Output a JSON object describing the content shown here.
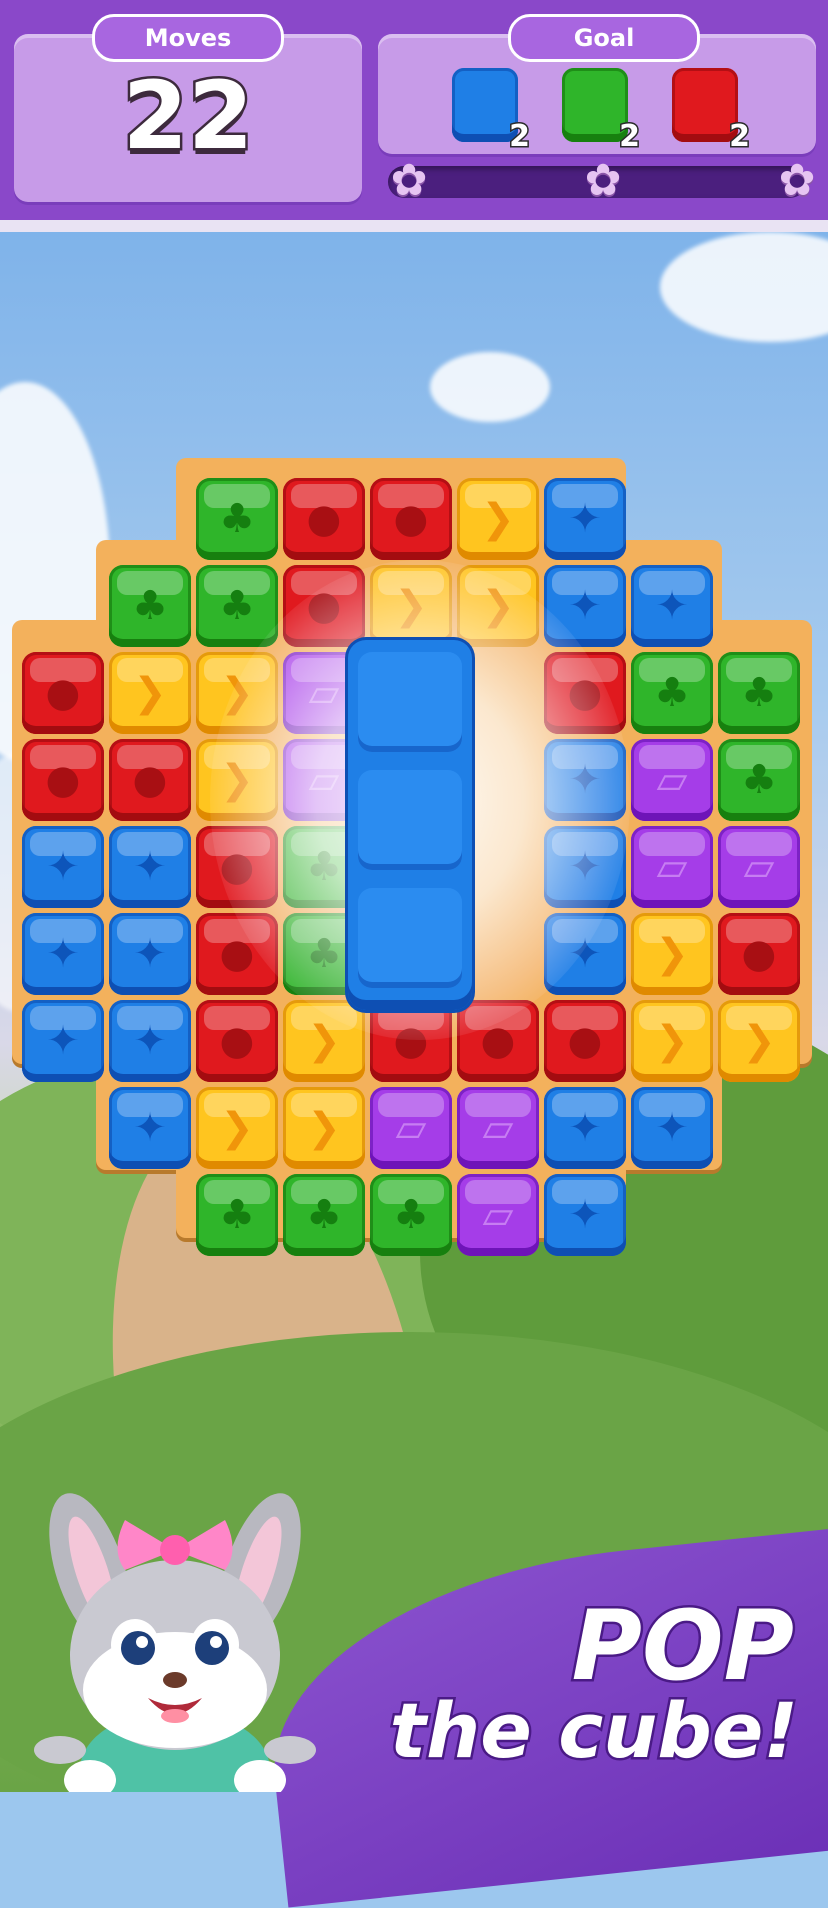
{
  "hud": {
    "moves_label": "Moves",
    "moves_value": "22",
    "goal_label": "Goal",
    "goals": [
      {
        "color": "blue",
        "count": "2",
        "icon": "blue-cube-icon"
      },
      {
        "color": "green",
        "count": "2",
        "icon": "green-cube-icon"
      },
      {
        "color": "red",
        "count": "2",
        "icon": "red-cube-icon"
      }
    ],
    "progress_fraction": 0,
    "stars": 3
  },
  "colors": {
    "hud_purple": "#8a48c9",
    "red": "#e0191e",
    "green": "#2fb52a",
    "blue": "#1f7fe6",
    "yellow": "#ffc51f",
    "purple": "#a53de8"
  },
  "board": {
    "rows": [
      [
        "",
        "",
        "G",
        "R",
        "R",
        "Y",
        "B",
        "",
        ""
      ],
      [
        "",
        "G",
        "G",
        "R",
        "Y",
        "Y",
        "B",
        "B",
        ""
      ],
      [
        "R",
        "Y",
        "Y",
        "P",
        "",
        "",
        "R",
        "G",
        "G"
      ],
      [
        "R",
        "R",
        "Y",
        "P",
        "",
        "",
        "B",
        "P",
        "G"
      ],
      [
        "B",
        "B",
        "R",
        "G",
        "",
        "",
        "B",
        "P",
        "P"
      ],
      [
        "B",
        "B",
        "R",
        "G",
        "",
        "",
        "B",
        "Y",
        "R"
      ],
      [
        "B",
        "B",
        "R",
        "Y",
        "R",
        "R",
        "R",
        "Y",
        "Y"
      ],
      [
        "",
        "B",
        "Y",
        "Y",
        "P",
        "P",
        "B",
        "B",
        ""
      ],
      [
        "",
        "",
        "G",
        "G",
        "G",
        "P",
        "B",
        "",
        ""
      ]
    ],
    "highlighted_column": {
      "color": "blue",
      "cubes": 3
    }
  },
  "banner": {
    "line1": "POP",
    "line2": "the cube!"
  },
  "mascot": "bunny-mascot"
}
